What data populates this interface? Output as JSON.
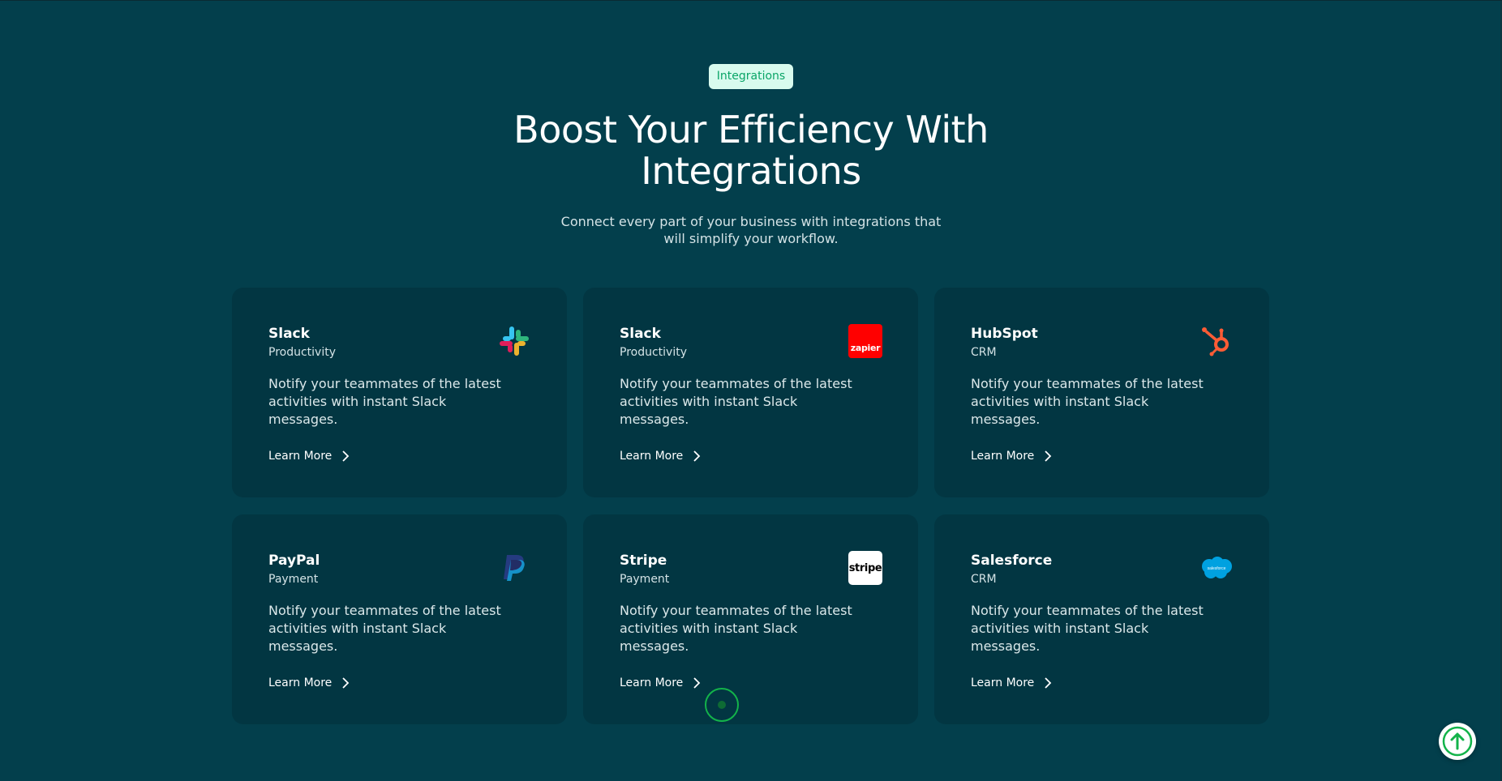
{
  "section": {
    "badge": "Integrations",
    "title": "Boost Your Efficiency With Integrations",
    "subtitle": "Connect every part of your business with integrations that will simplify your workflow."
  },
  "cards": [
    {
      "name": "Slack",
      "category": "Productivity",
      "description": "Notify your teammates of the latest activities with instant Slack messages.",
      "cta": "Learn More",
      "icon": "slack-logo"
    },
    {
      "name": "Slack",
      "category": "Productivity",
      "description": "Notify your teammates of the latest activities with instant Slack messages.",
      "cta": "Learn More",
      "icon": "zapier-logo",
      "logo_text": "zapier"
    },
    {
      "name": "HubSpot",
      "category": "CRM",
      "description": "Notify your teammates of the latest activities with instant Slack messages.",
      "cta": "Learn More",
      "icon": "hubspot-logo"
    },
    {
      "name": "PayPal",
      "category": "Payment",
      "description": "Notify your teammates of the latest activities with instant Slack messages.",
      "cta": "Learn More",
      "icon": "paypal-logo"
    },
    {
      "name": "Stripe",
      "category": "Payment",
      "description": "Notify your teammates of the latest activities with instant Slack messages.",
      "cta": "Learn More",
      "icon": "stripe-logo",
      "logo_text": "stripe"
    },
    {
      "name": "Salesforce",
      "category": "CRM",
      "description": "Notify your teammates of the latest activities with instant Slack messages.",
      "cta": "Learn More",
      "icon": "salesforce-logo",
      "logo_text": "salesforce"
    }
  ],
  "scroll_top": {
    "icon": "arrow-up-icon"
  },
  "colors": {
    "background": "#033f4c",
    "card": "#023642",
    "badge_bg": "#d8fbee",
    "badge_text": "#0aa567",
    "accent_green": "#13b34a"
  }
}
